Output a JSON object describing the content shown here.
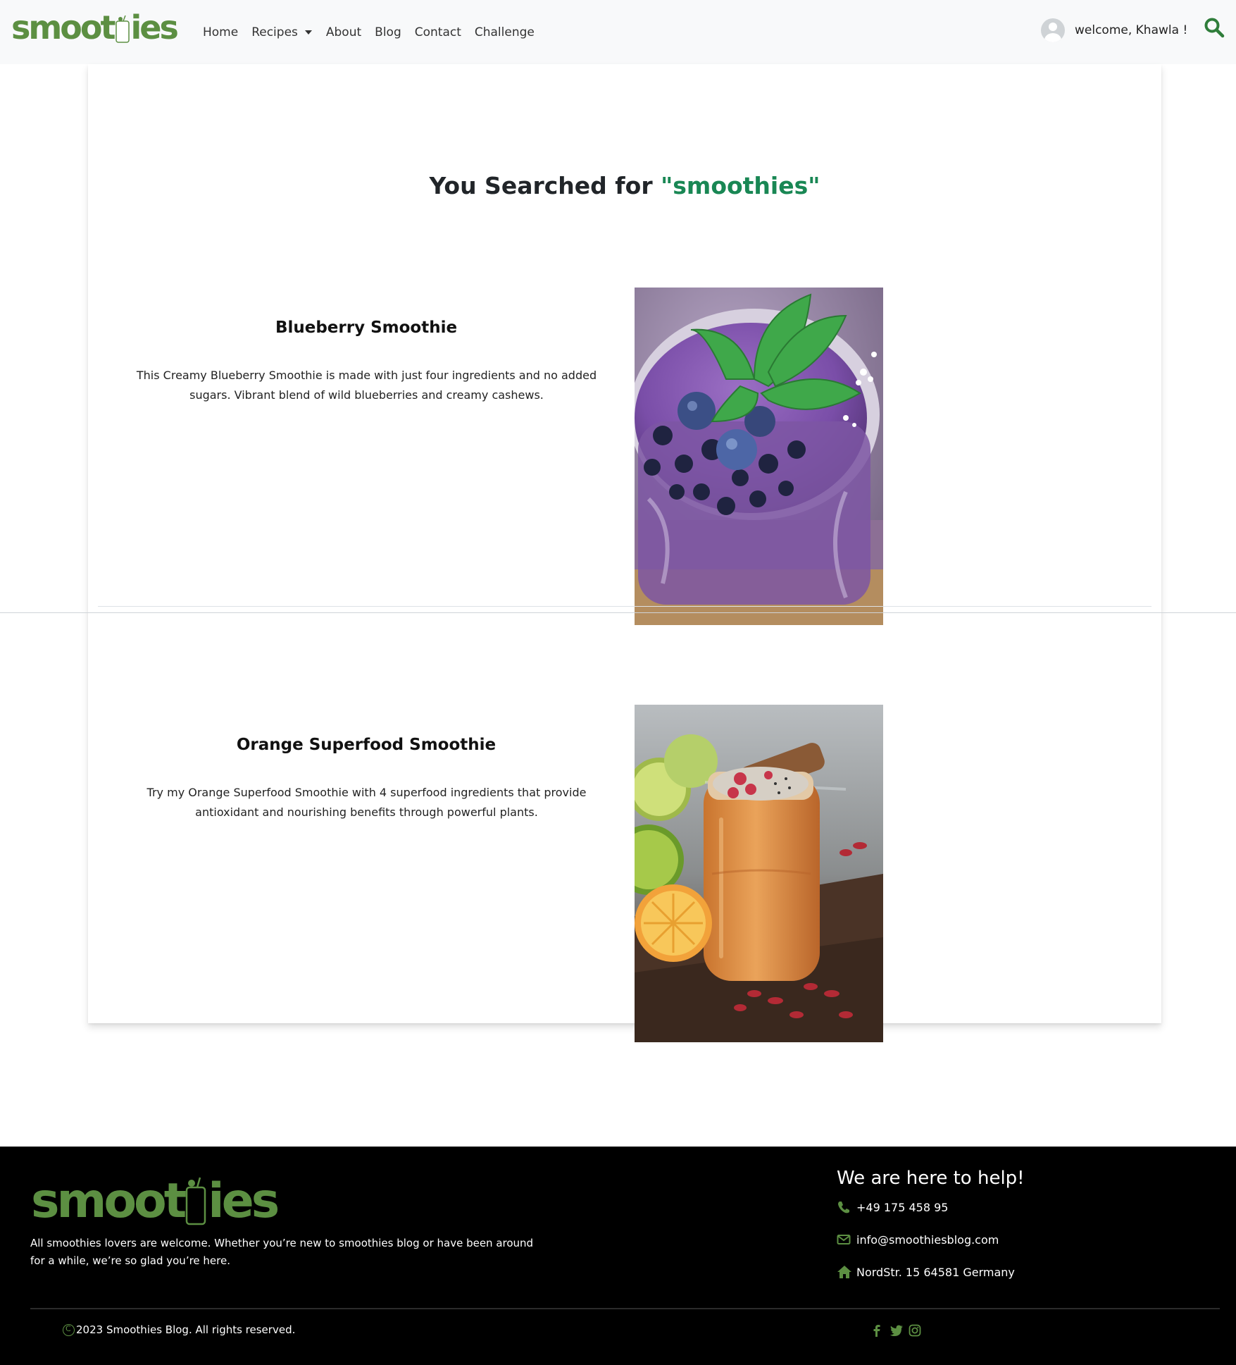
{
  "brand": {
    "logo_text_left": "smoot",
    "logo_text_right": "ies",
    "accent_color": "#5c8f42",
    "highlight_color": "#198754"
  },
  "nav": {
    "items": [
      {
        "label": "Home"
      },
      {
        "label": "Recipes"
      },
      {
        "label": "About"
      },
      {
        "label": "Blog"
      },
      {
        "label": "Contact"
      },
      {
        "label": "Challenge"
      }
    ],
    "welcome": "welcome, Khawla !",
    "avatar_icon": "user-avatar-icon",
    "search_icon": "search-icon"
  },
  "search": {
    "prefix": "You Searched for ",
    "term": "\"smoothies\""
  },
  "results": [
    {
      "title": "Blueberry Smoothie",
      "description": "This Creamy Blueberry Smoothie is made with just four ingredients and no added sugars. Vibrant blend of wild blueberries and creamy cashews."
    },
    {
      "title": "Orange Superfood Smoothie",
      "description": "Try my Orange Superfood Smoothie with 4 superfood ingredients that provide antioxidant and nourishing benefits through powerful plants."
    }
  ],
  "footer": {
    "about": "All smoothies lovers are welcome. Whether you’re new to smoothies blog or have been around for a while, we’re so glad you’re here.",
    "help_title": "We are here to help!",
    "phone": "+49 175 458 95",
    "email": "info@smoothiesblog.com",
    "address": "NordStr. 15 64581 Germany",
    "copyright": "2023 Smoothies Blog. All rights reserved.",
    "social": [
      "facebook-icon",
      "twitter-icon",
      "instagram-icon"
    ]
  }
}
